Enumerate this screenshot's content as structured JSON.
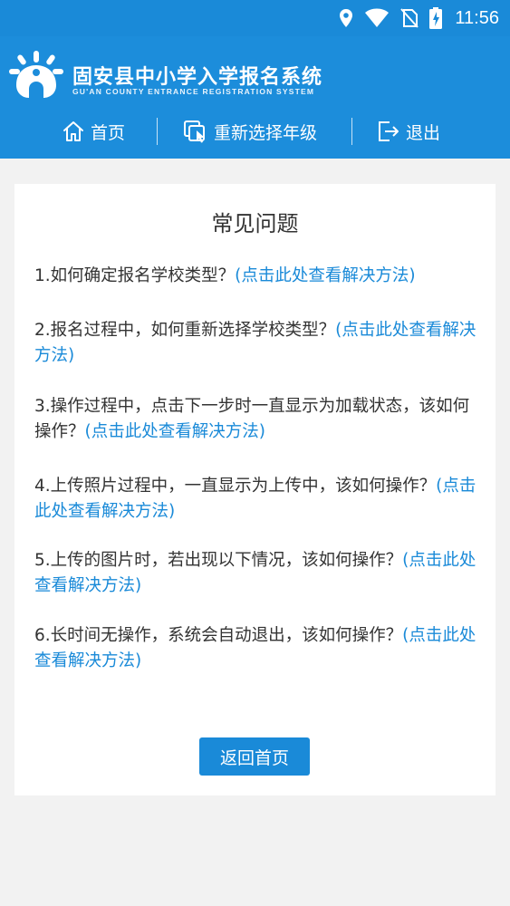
{
  "status_bar": {
    "time": "11:56",
    "icons": [
      "location-icon",
      "wifi-icon",
      "no-sim-icon",
      "battery-charging-icon"
    ]
  },
  "header": {
    "title": "固安县中小学入学报名系统",
    "subtitle": "GU'AN COUNTY ENTRANCE REGISTRATION SYSTEM"
  },
  "nav": {
    "home_label": "首页",
    "reselect_label": "重新选择年级",
    "logout_label": "退出"
  },
  "faq": {
    "title": "常见问题",
    "items": [
      {
        "question": "1.如何确定报名学校类型？",
        "link": "(点击此处查看解决方法)"
      },
      {
        "question": "2.报名过程中，如何重新选择学校类型？",
        "link": "(点击此处查看解决方法)"
      },
      {
        "question": "3.操作过程中，点击下一步时一直显示为加载状态，该如何操作？",
        "link": "(点击此处查看解决方法)"
      },
      {
        "question": "4.上传照片过程中，一直显示为上传中，该如何操作？",
        "link": "(点击此处查看解决方法)"
      },
      {
        "question": "5.上传的图片时，若出现以下情况，该如何操作？",
        "link": "(点击此处查看解决方法)"
      },
      {
        "question": "6.长时间无操作，系统会自动退出，该如何操作？",
        "link": "(点击此处查看解决方法)"
      }
    ],
    "back_label": "返回首页"
  },
  "colors": {
    "primary": "#1c8ddb",
    "link": "#1a8ad8",
    "background": "#f2f2f2"
  }
}
